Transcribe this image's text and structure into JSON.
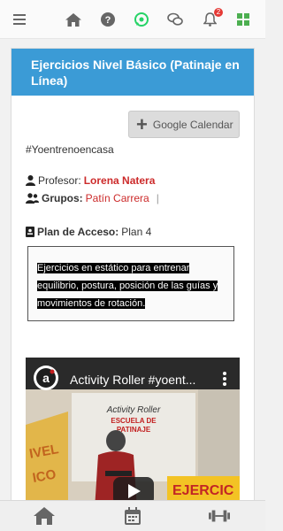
{
  "header": {
    "icons": [
      "menu-icon",
      "home-icon",
      "help-icon",
      "whatsapp-icon",
      "chat-icon",
      "bell-icon",
      "grid-icon"
    ],
    "notification_count": "2"
  },
  "card": {
    "title": "Ejercicios Nivel Básico (Patinaje en Línea)",
    "calendar_button": "Google Calendar",
    "hashtag": "#Yoentrenoencasa",
    "profesor_label": "Profesor:",
    "profesor_name": "Lorena Natera",
    "grupos_label": "Grupos:",
    "grupos_value": "Patín Carrera",
    "grupos_sep": "|",
    "plan_label": "Plan de Acceso:",
    "plan_value": "Plan 4",
    "description": "Ejercicios en estático para entrenar equilibrio, postura, posición de las guías y movimientos de rotación.",
    "video": {
      "title": "Activity Roller #yoent...",
      "banner_text_1": "Activity Roller",
      "banner_text_2": "ESCUELA DE",
      "banner_text_3": "PATINAJE",
      "side_text_1": "IVEL",
      "side_text_2": "ICO",
      "overlay_text": "EJERCIC"
    }
  },
  "bottom_nav": {
    "icons": [
      "home-icon",
      "calendar-icon",
      "dumbbell-icon"
    ]
  },
  "colors": {
    "header_blue": "#3b9bd6",
    "accent_red": "#cc2a2a",
    "whatsapp_green": "#25d366"
  }
}
